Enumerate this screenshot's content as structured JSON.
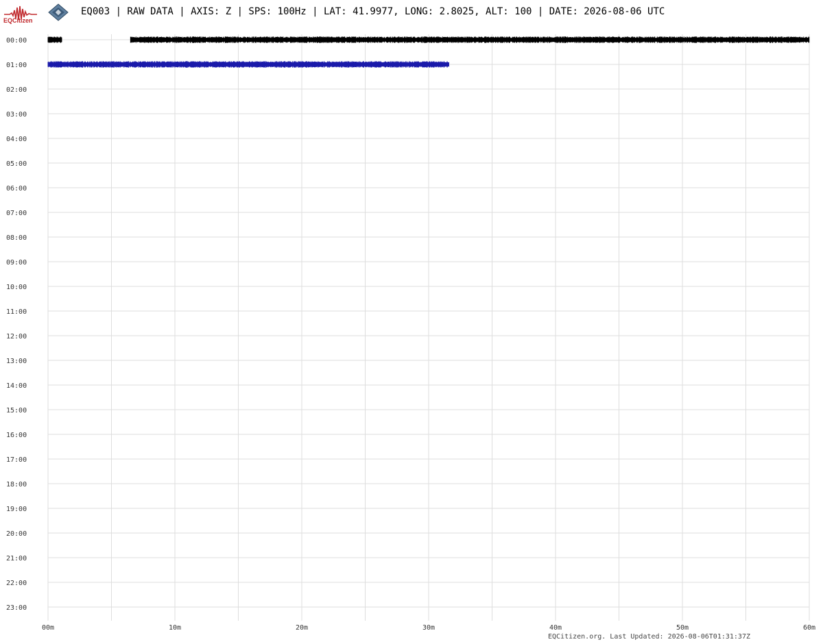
{
  "header": {
    "logo_text": "EQCitizen",
    "title": "EQ003 | RAW DATA | AXIS: Z | SPS: 100Hz | LAT: 41.9977, LONG: 2.8025, ALT: 100 | DATE: 2026-08-06 UTC",
    "logo_icon": "seismograph-waveform-icon",
    "device_icon": "sensor-board-icon"
  },
  "footer": {
    "text": "EQCitizen.org. Last Updated: 2026-08-06T01:31:37Z"
  },
  "colors": {
    "trace_even": "#000000",
    "trace_odd": "#1a1aaa",
    "grid": "#dddddd",
    "logo": "#c0282c"
  },
  "chart_data": {
    "type": "line",
    "title": "EQ003 | RAW DATA | AXIS: Z | SPS: 100Hz | LAT: 41.9977, LONG: 2.8025, ALT: 100 | DATE: 2026-08-06 UTC",
    "x_ticks": [
      "00m",
      "10m",
      "20m",
      "30m",
      "40m",
      "50m",
      "60m"
    ],
    "x_minor_grid_minutes": [
      0,
      5,
      10,
      15,
      20,
      25,
      30,
      35,
      40,
      45,
      50,
      55,
      60
    ],
    "xlim": [
      0,
      60
    ],
    "y_rows": [
      "00:00",
      "01:00",
      "02:00",
      "03:00",
      "04:00",
      "05:00",
      "06:00",
      "07:00",
      "08:00",
      "09:00",
      "10:00",
      "11:00",
      "12:00",
      "13:00",
      "14:00",
      "15:00",
      "16:00",
      "17:00",
      "18:00",
      "19:00",
      "20:00",
      "21:00",
      "22:00",
      "23:00"
    ],
    "grid": true,
    "series": [
      {
        "row": "00:00",
        "segments": [
          [
            0,
            1.1
          ],
          [
            6.5,
            60
          ]
        ],
        "color": "#000000"
      },
      {
        "row": "01:00",
        "segments": [
          [
            0,
            31.6
          ]
        ],
        "color": "#1a1aaa"
      }
    ]
  }
}
